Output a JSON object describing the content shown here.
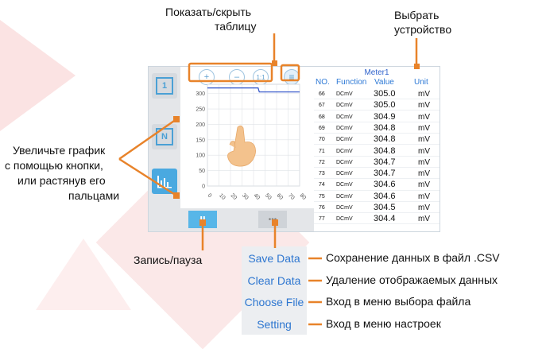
{
  "annotations": {
    "show_hide_table": [
      "Показать/скрыть",
      "таблицу"
    ],
    "select_device": [
      "Выбрать",
      "устройство"
    ],
    "zoom_hint": [
      "Увеличьте график",
      "с помощью кнопки,",
      "или растянув его",
      "пальцами"
    ],
    "record_pause": "Запись/пауза"
  },
  "sidebar": {
    "buttons": [
      {
        "icon": "zoom-fit-icon",
        "glyph": "1"
      },
      {
        "icon": "n-icon",
        "glyph": "N"
      },
      {
        "icon": "bar-chart-icon",
        "glyph": "",
        "active": true
      }
    ]
  },
  "chart_controls": {
    "zoom_in": "+",
    "zoom_out": "–",
    "reset": "1:1",
    "table_toggle": "≡"
  },
  "chart_data": {
    "type": "line",
    "x_ticks": [
      "0",
      "10",
      "20",
      "30",
      "40",
      "50",
      "60",
      "70",
      "80"
    ],
    "y_ticks": [
      "0",
      "50",
      "100",
      "150",
      "200",
      "250",
      "300"
    ],
    "xlim": [
      0,
      80
    ],
    "ylim": [
      0,
      330
    ],
    "grid": true,
    "series": [
      {
        "color": "#2a4fc7",
        "x": [
          0,
          8,
          20,
          40,
          44,
          45,
          60,
          80
        ],
        "y": [
          318,
          318,
          318,
          318,
          318,
          305,
          305,
          305
        ]
      }
    ]
  },
  "table": {
    "meter": "Meter1",
    "headers": [
      "NO.",
      "Function",
      "Value",
      "Unit"
    ],
    "rows": [
      {
        "no": "66",
        "fn": "DCmV",
        "value": "305.0",
        "unit": "mV"
      },
      {
        "no": "67",
        "fn": "DCmV",
        "value": "305.0",
        "unit": "mV"
      },
      {
        "no": "68",
        "fn": "DCmV",
        "value": "304.9",
        "unit": "mV"
      },
      {
        "no": "69",
        "fn": "DCmV",
        "value": "304.8",
        "unit": "mV"
      },
      {
        "no": "70",
        "fn": "DCmV",
        "value": "304.8",
        "unit": "mV"
      },
      {
        "no": "71",
        "fn": "DCmV",
        "value": "304.8",
        "unit": "mV"
      },
      {
        "no": "72",
        "fn": "DCmV",
        "value": "304.7",
        "unit": "mV"
      },
      {
        "no": "73",
        "fn": "DCmV",
        "value": "304.7",
        "unit": "mV"
      },
      {
        "no": "74",
        "fn": "DCmV",
        "value": "304.6",
        "unit": "mV"
      },
      {
        "no": "75",
        "fn": "DCmV",
        "value": "304.6",
        "unit": "mV"
      },
      {
        "no": "76",
        "fn": "DCmV",
        "value": "304.5",
        "unit": "mV"
      },
      {
        "no": "77",
        "fn": "DCmV",
        "value": "304.4",
        "unit": "mV"
      }
    ]
  },
  "bottom_bar": {
    "pause": "II",
    "more": "•••"
  },
  "menu": {
    "items": [
      {
        "label": "Save Data",
        "desc": "Сохранение данных в файл .CSV"
      },
      {
        "label": "Clear Data",
        "desc": "Удаление отображаемых данных"
      },
      {
        "label": "Choose File",
        "desc": "Вход в меню выбора файла"
      },
      {
        "label": "Setting",
        "desc": "Вход в меню настроек"
      }
    ]
  },
  "colors": {
    "accent": "#57b6e8",
    "annotation": "#e8832a",
    "link": "#2d76d0",
    "line": "#2a4fc7"
  }
}
